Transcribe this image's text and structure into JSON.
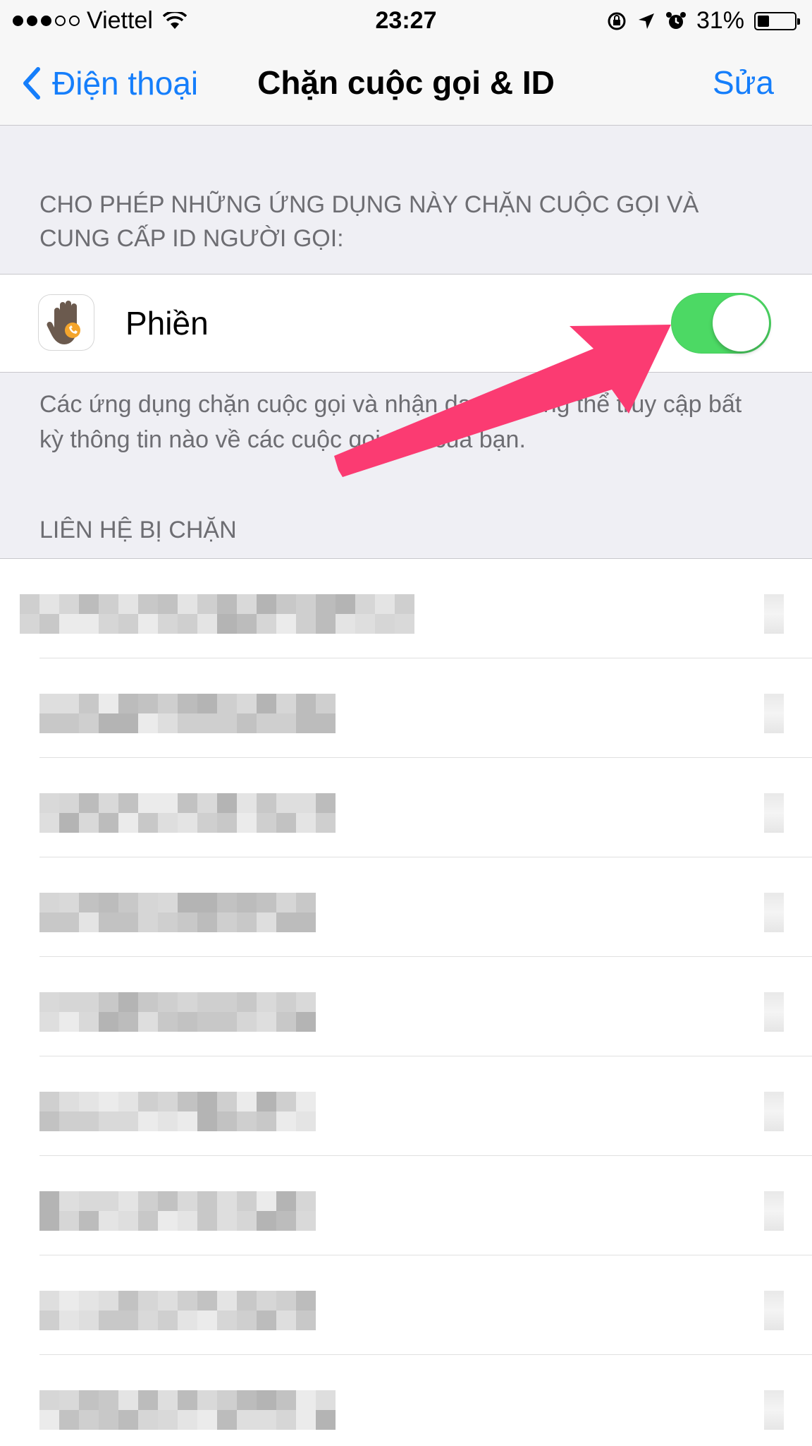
{
  "status_bar": {
    "carrier": "Viettel",
    "time": "23:27",
    "battery_percent": "31%",
    "battery_level": 0.31,
    "icons": [
      "wifi-icon",
      "orientation-lock-icon",
      "location-arrow-icon",
      "alarm-icon",
      "battery-icon"
    ]
  },
  "nav": {
    "back_label": "Điện thoại",
    "title": "Chặn cuộc gọi & ID",
    "edit_label": "Sửa"
  },
  "apps_section": {
    "header": "CHO PHÉP NHỮNG ỨNG DỤNG NÀY CHẶN CUỘC GỌI VÀ CUNG CẤP ID NGƯỜI GỌI:",
    "apps": [
      {
        "name": "Phiền",
        "icon": "hand-phone-app-icon",
        "enabled": true
      }
    ],
    "footer": "Các ứng dụng chặn cuộc gọi và nhận dạng không thể truy cập bất kỳ thông tin nào về các cuộc gọi đến của bạn."
  },
  "blocked_section": {
    "header": "LIÊN HỆ BỊ CHẶN",
    "contacts_count": 9,
    "contacts_obscured": true
  },
  "colors": {
    "accent": "#157efb",
    "toggle_on": "#4cd964",
    "annotation_arrow": "#fb3b72",
    "background": "#efeff4"
  }
}
